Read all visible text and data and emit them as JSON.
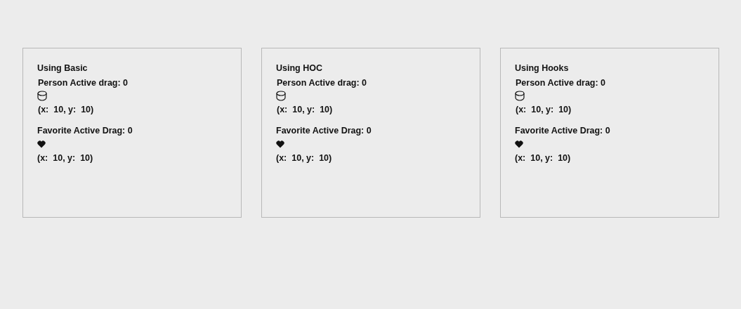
{
  "panels": [
    {
      "title": "Using Basic",
      "items": [
        {
          "kind": "person",
          "label": "Person Active drag: 0",
          "coords": "(x:  10, y:  10)"
        },
        {
          "kind": "favorite",
          "label": "Favorite Active Drag: 0",
          "coords": "(x:  10, y:  10)"
        }
      ]
    },
    {
      "title": "Using HOC",
      "items": [
        {
          "kind": "person",
          "label": "Person Active drag: 0",
          "coords": "(x:  10, y:  10)"
        },
        {
          "kind": "favorite",
          "label": "Favorite Active Drag: 0",
          "coords": "(x:  10, y:  10)"
        }
      ]
    },
    {
      "title": "Using Hooks",
      "items": [
        {
          "kind": "person",
          "label": "Person Active drag: 0",
          "coords": "(x:  10, y:  10)"
        },
        {
          "kind": "favorite",
          "label": "Favorite Active Drag: 0",
          "coords": "(x:  10, y:  10)"
        }
      ]
    }
  ]
}
